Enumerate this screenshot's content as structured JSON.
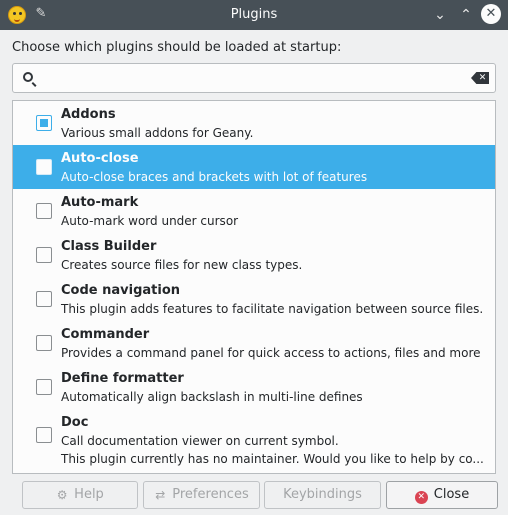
{
  "window": {
    "title": "Plugins",
    "pin_glyph": "✎",
    "minimize_glyph": "⌄",
    "maximize_glyph": "⌃",
    "close_glyph": "✕"
  },
  "prompt": "Choose which plugins should be loaded at startup:",
  "search": {
    "value": "",
    "placeholder": "",
    "clear_glyph": "✕"
  },
  "plugins": [
    {
      "name": "Addons",
      "desc": "Various small addons for Geany.",
      "checked": true
    },
    {
      "name": "Auto-close",
      "desc": "Auto-close braces and brackets with lot of features",
      "checked": false,
      "selected": true
    },
    {
      "name": "Auto-mark",
      "desc": "Auto-mark word under cursor",
      "checked": false
    },
    {
      "name": "Class Builder",
      "desc": "Creates source files for new class types.",
      "checked": false
    },
    {
      "name": "Code navigation",
      "desc": "This plugin adds features to facilitate navigation between source files.",
      "checked": false
    },
    {
      "name": "Commander",
      "desc": "Provides a command panel for quick access to actions, files and more",
      "checked": false
    },
    {
      "name": "Define formatter",
      "desc": "Automatically align backslash in multi-line defines",
      "checked": false
    },
    {
      "name": "Doc",
      "desc": "Call documentation viewer on current symbol.",
      "desc2": "This plugin currently has no maintainer. Would you like to help by co...",
      "checked": false
    }
  ],
  "buttons": {
    "help": {
      "label": "Help",
      "glyph": "⚙"
    },
    "preferences": {
      "label": "Preferences",
      "glyph": "⇄"
    },
    "keybindings": {
      "label": "Keybindings"
    },
    "close": {
      "label": "Close",
      "glyph": "✕"
    }
  },
  "colors": {
    "selection": "#3daee9",
    "titlebar": "#475057",
    "close_icon": "#da4453"
  }
}
